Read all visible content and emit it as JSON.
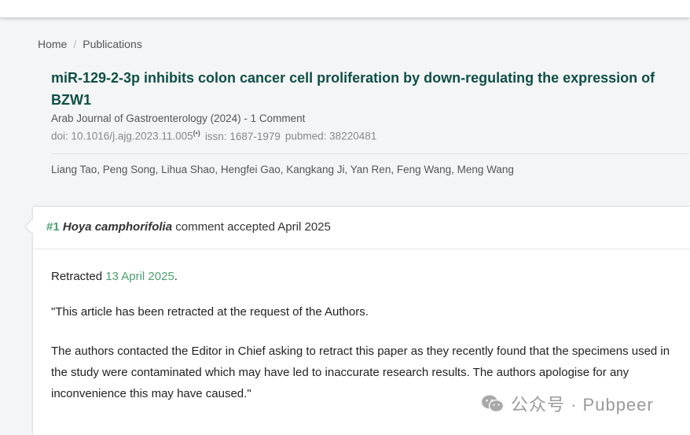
{
  "breadcrumb": {
    "home": "Home",
    "separator": "/",
    "publications": "Publications"
  },
  "article": {
    "title": "miR-129-2-3p inhibits colon cancer cell proliferation by down-regulating the expression of BZW1",
    "journal_line": "Arab Journal of Gastroenterology (2024) - 1 Comment",
    "doi": "doi: 10.1016/j.ajg.2023.11.005",
    "doi_marker": "(•)",
    "issn": "issn: 1687-1979",
    "pubmed": "pubmed: 38220481",
    "authors": "Liang Tao, Peng Song, Lihua Shao, Hengfei Gao, Kangkang Ji, Yan Ren, Feng Wang, Meng Wang"
  },
  "comment": {
    "number": "#1",
    "commenter": "Hoya camphorifolia",
    "status": "comment accepted April 2025",
    "retracted_prefix": "Retracted",
    "retracted_date": "13 April 2025",
    "retracted_suffix": ".",
    "quote_line": "\"This article has been retracted at the request of the Authors.",
    "body": "The authors contacted the Editor in Chief asking to retract this paper as they recently found that the specimens used in the study were contaminated which may have led to inaccurate research results. The authors apologise for any inconvenience this may have caused.\""
  },
  "watermark": {
    "text": "公众号 · Pubpeer",
    "icon": "wechat-icon"
  },
  "colors": {
    "title": "#0f4f46",
    "accent_green": "#4a9f6e",
    "background": "#f4f5f6"
  }
}
